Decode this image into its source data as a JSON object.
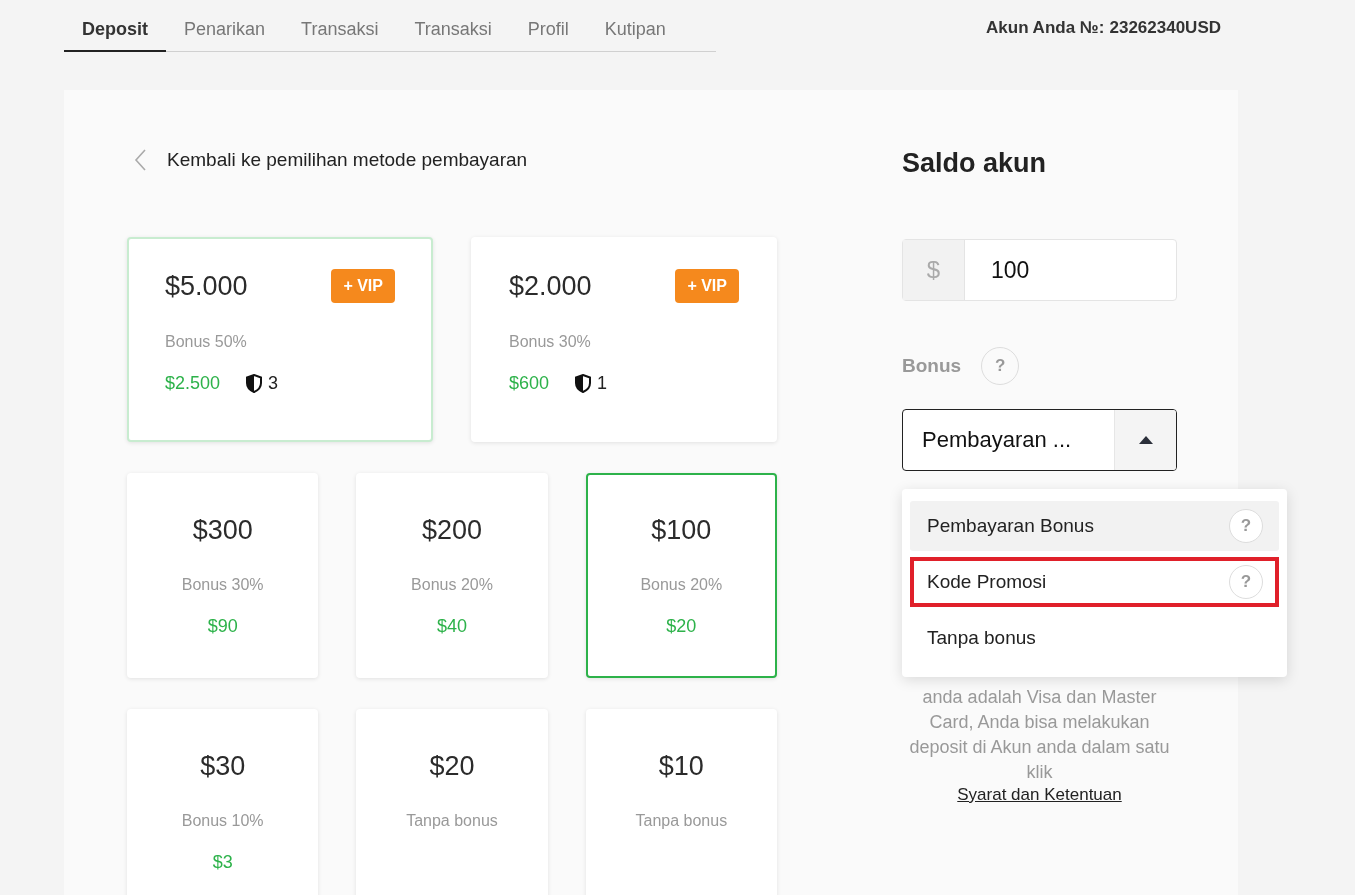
{
  "tabs": [
    {
      "label": "Deposit",
      "selected": true
    },
    {
      "label": "Penarikan",
      "selected": false
    },
    {
      "label": "Transaksi",
      "selected": false
    },
    {
      "label": "Transaksi",
      "selected": false
    },
    {
      "label": "Profil",
      "selected": false
    },
    {
      "label": "Kutipan",
      "selected": false
    }
  ],
  "account": {
    "label": "Akun Anda №:",
    "number": "23262340USD"
  },
  "back_link": "Kembali ke pemilihan metode pembayaran",
  "packages": [
    {
      "kind": "vip",
      "amount": "$5.000",
      "badge": "+ VIP",
      "bonus": "Bonus 50%",
      "reward": "$2.500",
      "shields": "3",
      "selected": false,
      "hovered": true
    },
    {
      "kind": "vip",
      "amount": "$2.000",
      "badge": "+ VIP",
      "bonus": "Bonus 30%",
      "reward": "$600",
      "shields": "1",
      "selected": false,
      "hovered": false
    },
    {
      "kind": "regular",
      "amount": "$300",
      "bonus": "Bonus 30%",
      "reward": "$90",
      "selected": false,
      "hovered": false
    },
    {
      "kind": "regular",
      "amount": "$200",
      "bonus": "Bonus 20%",
      "reward": "$40",
      "selected": false,
      "hovered": false
    },
    {
      "kind": "regular",
      "amount": "$100",
      "bonus": "Bonus 20%",
      "reward": "$20",
      "selected": true,
      "hovered": false
    },
    {
      "kind": "regular",
      "amount": "$30",
      "bonus": "Bonus 10%",
      "reward": "$3",
      "selected": false,
      "hovered": false
    },
    {
      "kind": "regular",
      "amount": "$20",
      "bonus": "Tanpa bonus",
      "selected": false,
      "hovered": false
    },
    {
      "kind": "regular",
      "amount": "$10",
      "bonus": "Tanpa bonus",
      "selected": false,
      "hovered": false
    }
  ],
  "balance": {
    "title": "Saldo akun",
    "currency": "$",
    "value": "100"
  },
  "bonus": {
    "label": "Bonus",
    "help": "?",
    "select_value": "Pembayaran ...",
    "expanded": true,
    "options": [
      {
        "label": "Pembayaran Bonus",
        "help": "?",
        "selected": true,
        "highlighted": false
      },
      {
        "label": "Kode Promosi",
        "help": "?",
        "selected": false,
        "highlighted": true
      },
      {
        "label": "Tanpa bonus",
        "selected": false,
        "highlighted": false
      }
    ]
  },
  "info_text": "anda adalah Visa dan Master Card, Anda bisa melakukan deposit di Akun anda dalam satu klik",
  "terms_link": "Syarat dan Ketentuan"
}
